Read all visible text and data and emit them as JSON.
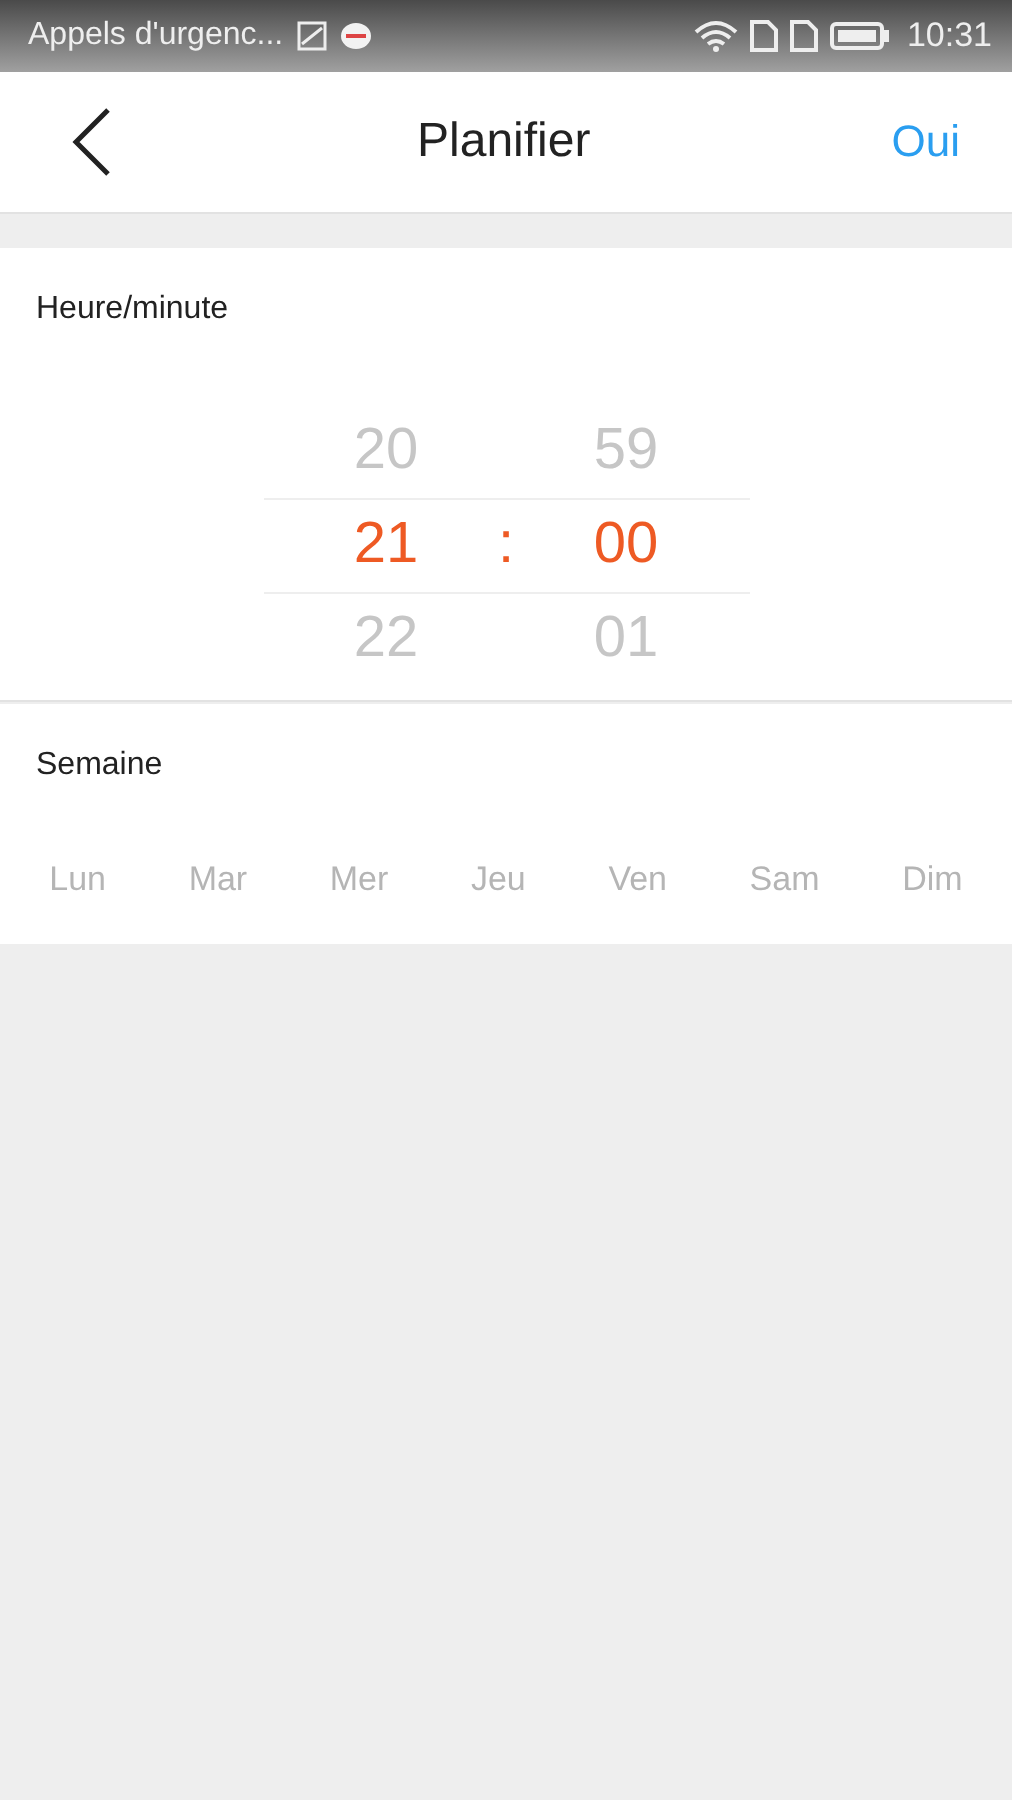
{
  "status_bar": {
    "carrier": "Appels d'urgenc...",
    "time": "10:31"
  },
  "header": {
    "title": "Planifier",
    "confirm": "Oui"
  },
  "time_section": {
    "label": "Heure/minute",
    "separator": ":",
    "hours": [
      {
        "text": "20",
        "selected": false
      },
      {
        "text": "21",
        "selected": true
      },
      {
        "text": "22",
        "selected": false
      }
    ],
    "minutes": [
      {
        "text": "59",
        "selected": false
      },
      {
        "text": "00",
        "selected": true
      },
      {
        "text": "01",
        "selected": false
      }
    ]
  },
  "week_section": {
    "label": "Semaine",
    "days": [
      {
        "label": "Lun",
        "selected": false
      },
      {
        "label": "Mar",
        "selected": false
      },
      {
        "label": "Mer",
        "selected": false
      },
      {
        "label": "Jeu",
        "selected": false
      },
      {
        "label": "Ven",
        "selected": false
      },
      {
        "label": "Sam",
        "selected": false
      },
      {
        "label": "Dim",
        "selected": false
      }
    ]
  }
}
